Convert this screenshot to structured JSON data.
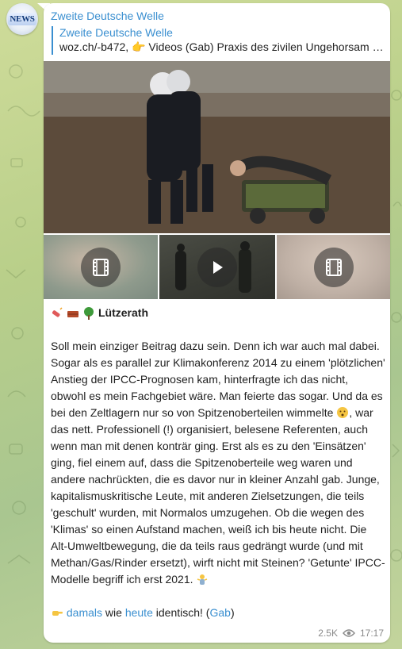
{
  "post": {
    "channel": "Zweite Deutsche Welle",
    "forward": {
      "source": "Zweite Deutsche Welle",
      "preview": "woz.ch/-b472, 👉 Videos (Gab) Praxis des zivilen Ungehorsam a…"
    },
    "headline": "Lützerath",
    "body_lines": [
      "Soll mein einziger Beitrag dazu sein. Denn ich war auch mal dabei.",
      "Sogar als es parallel zur Klimakonferenz 2014 zu einem 'plötzlichen'",
      "Anstieg der IPCC-Prognosen kam, hinterfragte ich das nicht,",
      "obwohl es mein Fachgebiet wäre. Man feierte das sogar. Und da es",
      "bei den Zeltlagern nur so von Spitzenoberteilen wimmelte",
      ", war",
      "das nett. Professionell (!) organisiert, belesene Referenten, auch",
      "wenn man mit denen konträr ging. Erst als es zu den 'Einsätzen'",
      "ging, fiel einem auf, dass die Spitzenoberteile weg waren und",
      "andere nachrückten, die es davor nur in kleiner Anzahl gab. Junge,",
      "kapitalismuskritische Leute, mit anderen Zielsetzungen, die teils",
      "'geschult' wurden, mit Normalos umzugehen. Ob die wegen des",
      "'Klimas' so einen Aufstand machen, weiß ich bis heute nicht. Die",
      "Alt-Umweltbewegung, die da teils raus gedrängt wurde (und mit",
      "Methan/Gas/Rinder ersetzt), wirft nicht mit Steinen? 'Getunte' IPCC-",
      "Modelle begriff ich erst 2021."
    ],
    "links_line": {
      "link1": "damals",
      "word": "wie",
      "link2": "heute",
      "tail": "identisch! (",
      "link3": "Gab",
      "close": ")"
    },
    "views": "2.5K",
    "time": "17:17",
    "avatar_label": "NEWS"
  },
  "icons": {
    "avatar": "news-logo-icon",
    "views": "eye-icon",
    "video": "film-icon",
    "play": "play-icon"
  },
  "colors": {
    "accent": "#3a8fd0",
    "bubble": "#ffffff"
  }
}
